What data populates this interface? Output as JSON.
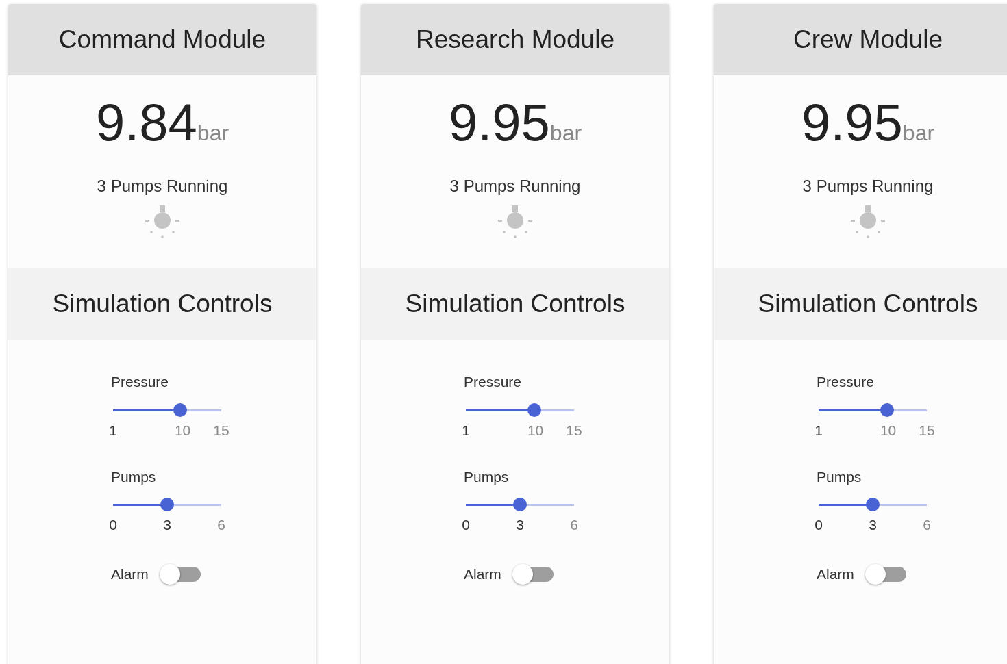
{
  "modules": [
    {
      "title": "Command Module",
      "reading": "9.84",
      "unit": "bar",
      "status": "3 Pumps Running",
      "lamp_lit": false,
      "controls_title": "Simulation Controls",
      "sliders": [
        {
          "kind": "pressure",
          "label": "Pressure",
          "level": 0.62,
          "marks": [
            {
              "text": "1",
              "active": true
            },
            {
              "text": "10",
              "active": false
            },
            {
              "text": "15",
              "active": false
            }
          ]
        },
        {
          "kind": "pumps",
          "label": "Pumps",
          "level": 0.5,
          "marks": [
            {
              "text": "0",
              "active": true
            },
            {
              "text": "3",
              "active": true
            },
            {
              "text": "6",
              "active": false
            }
          ]
        }
      ],
      "alarm": {
        "label": "Alarm",
        "on": false
      }
    },
    {
      "title": "Research Module",
      "reading": "9.95",
      "unit": "bar",
      "status": "3 Pumps Running",
      "lamp_lit": false,
      "controls_title": "Simulation Controls",
      "sliders": [
        {
          "kind": "pressure",
          "label": "Pressure",
          "level": 0.63,
          "marks": [
            {
              "text": "1",
              "active": true
            },
            {
              "text": "10",
              "active": false
            },
            {
              "text": "15",
              "active": false
            }
          ]
        },
        {
          "kind": "pumps",
          "label": "Pumps",
          "level": 0.5,
          "marks": [
            {
              "text": "0",
              "active": true
            },
            {
              "text": "3",
              "active": true
            },
            {
              "text": "6",
              "active": false
            }
          ]
        }
      ],
      "alarm": {
        "label": "Alarm",
        "on": false
      }
    },
    {
      "title": "Crew Module",
      "reading": "9.95",
      "unit": "bar",
      "status": "3 Pumps Running",
      "lamp_lit": false,
      "controls_title": "Simulation Controls",
      "sliders": [
        {
          "kind": "pressure",
          "label": "Pressure",
          "level": 0.63,
          "marks": [
            {
              "text": "1",
              "active": true
            },
            {
              "text": "10",
              "active": false
            },
            {
              "text": "15",
              "active": false
            }
          ]
        },
        {
          "kind": "pumps",
          "label": "Pumps",
          "level": 0.5,
          "marks": [
            {
              "text": "0",
              "active": true
            },
            {
              "text": "3",
              "active": true
            },
            {
              "text": "6",
              "active": false
            }
          ]
        }
      ],
      "alarm": {
        "label": "Alarm",
        "on": false
      }
    }
  ]
}
